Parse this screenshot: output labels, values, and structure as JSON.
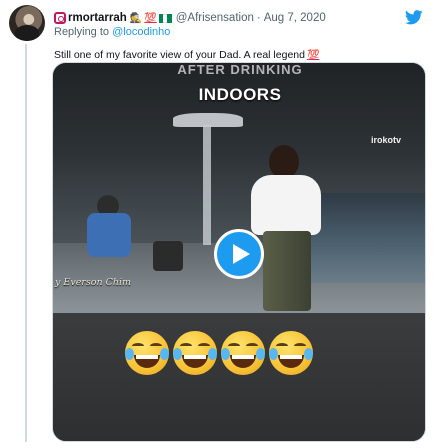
{
  "tweet": {
    "username": "rmortarrah",
    "username_emoji": "🕵",
    "hundred_badge": "💯",
    "handle": "@Afrisensation",
    "separator": "·",
    "date": "Aug 7, 2020",
    "replying_to_label": "Replying to",
    "replying_to_handle": "@locodinho",
    "text": "Still one of my favorite view  of your Dad. A real legend",
    "text_emoji": "💯"
  },
  "colors": {
    "twitter_blue": "#1d9bf0",
    "nigeria_green": "#008751",
    "nigeria_white": "#ffffff",
    "hundred_red": "#e0245e"
  },
  "icons": {
    "platform": "twitter-bird-icon",
    "play": "play-icon"
  },
  "media": {
    "caption_top": "AFTER DRINKING",
    "caption_main": "INDOORS",
    "watermark": "irokotv",
    "credit": "y Everson Chim",
    "emoji_overlay": [
      "😂",
      "😂",
      "😂",
      "😂"
    ]
  }
}
